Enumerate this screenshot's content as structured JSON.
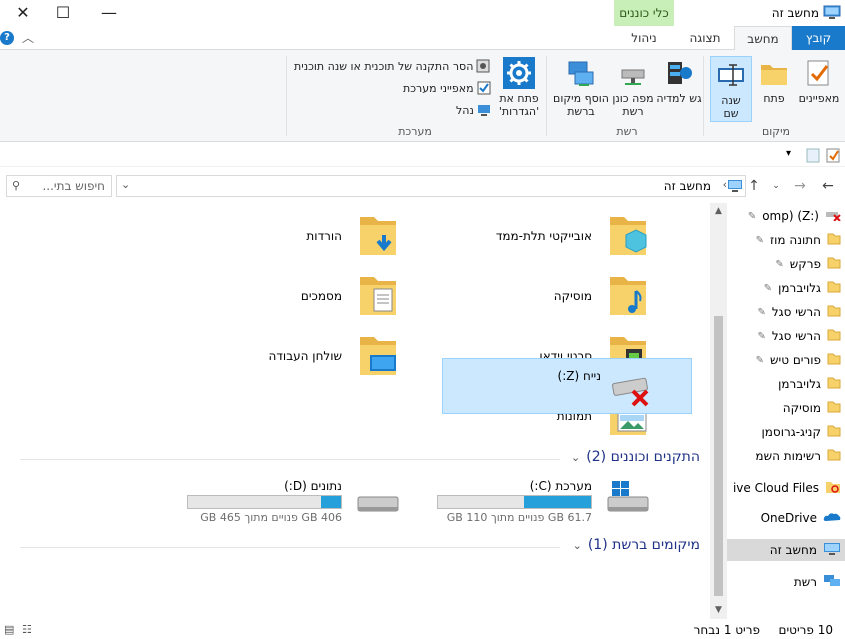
{
  "window": {
    "title": "מחשב זה",
    "context_tab_label": "כלי כוננים",
    "minimize": "—",
    "maximize": "☐",
    "close": "✕"
  },
  "ribbon_tabs": [
    "קובץ",
    "מחשב",
    "תצוגה",
    "ניהול"
  ],
  "ribbon": {
    "location_group": "מיקום",
    "network_group": "רשת",
    "system_group": "מערכת",
    "properties": "מאפיינים",
    "open": "פתח",
    "rename": "שנה שם",
    "access_media": "גש למדיה",
    "map_drive": "מפה כונן רשת",
    "add_location": "הוסף מיקום ברשת",
    "open_settings": "פתח את 'הגדרות'",
    "uninstall": "הסר התקנה של תוכנית או שנה תוכנית",
    "system_props": "מאפייני מערכת",
    "manage": "נהל"
  },
  "address": {
    "path": "מחשב זה",
    "search_placeholder": "חיפוש בתי..."
  },
  "folders": [
    {
      "name": "אובייקטי תלת-ממד",
      "icon": "3d-objects-icon"
    },
    {
      "name": "הורדות",
      "icon": "downloads-icon"
    },
    {
      "name": "מוסיקה",
      "icon": "music-icon"
    },
    {
      "name": "מסמכים",
      "icon": "documents-icon"
    },
    {
      "name": "סרטי וידאו",
      "icon": "videos-icon"
    },
    {
      "name": "שולחן העבודה",
      "icon": "desktop-icon"
    },
    {
      "name": "תמונות",
      "icon": "pictures-icon"
    }
  ],
  "devices_section": "התקנים וכוננים (2)",
  "drives": [
    {
      "name": "מערכת (C:)",
      "free_text": "61.7 GB פנויים מתוך 110 GB",
      "used_fraction": 0.44
    },
    {
      "name": "נתונים (D:)",
      "free_text": "406 GB פנויים מתוך 465 GB",
      "used_fraction": 0.13
    }
  ],
  "network_section": "מיקומים ברשת (1)",
  "network_drive": {
    "name": "נייח (Z:)"
  },
  "nav_pane": [
    {
      "label": "omp) (Z:)",
      "pinned": true,
      "kind": "netdrive"
    },
    {
      "label": "חתונה מוז",
      "pinned": true,
      "kind": "folder"
    },
    {
      "label": "פרקש",
      "pinned": true,
      "kind": "folder"
    },
    {
      "label": "גלויברמן",
      "pinned": true,
      "kind": "folder"
    },
    {
      "label": "הרשי סגל",
      "pinned": true,
      "kind": "folder"
    },
    {
      "label": "הרשי סגל",
      "pinned": true,
      "kind": "folder"
    },
    {
      "label": "פורים טיש",
      "pinned": true,
      "kind": "folder"
    },
    {
      "label": "גלויברמן",
      "pinned": false,
      "kind": "folder"
    },
    {
      "label": "מוסיקה",
      "pinned": false,
      "kind": "folder"
    },
    {
      "label": "קניג-גרוסמן",
      "pinned": false,
      "kind": "folder"
    },
    {
      "label": "רשימות השמ",
      "pinned": false,
      "kind": "folder"
    },
    {
      "label": "ive Cloud Files",
      "pinned": false,
      "kind": "cloud"
    },
    {
      "label": "OneDrive",
      "pinned": false,
      "kind": "onedrive"
    },
    {
      "label": "מחשב זה",
      "pinned": false,
      "kind": "pc"
    },
    {
      "label": "רשת",
      "pinned": false,
      "kind": "network"
    }
  ],
  "status": {
    "items": "10 פריטים",
    "selected": "פריט 1 נבחר"
  },
  "colors": {
    "accent": "#1979ca",
    "selection": "#cce8ff",
    "drive_bar": "#26a0da",
    "context_tab": "#c9efb9"
  }
}
